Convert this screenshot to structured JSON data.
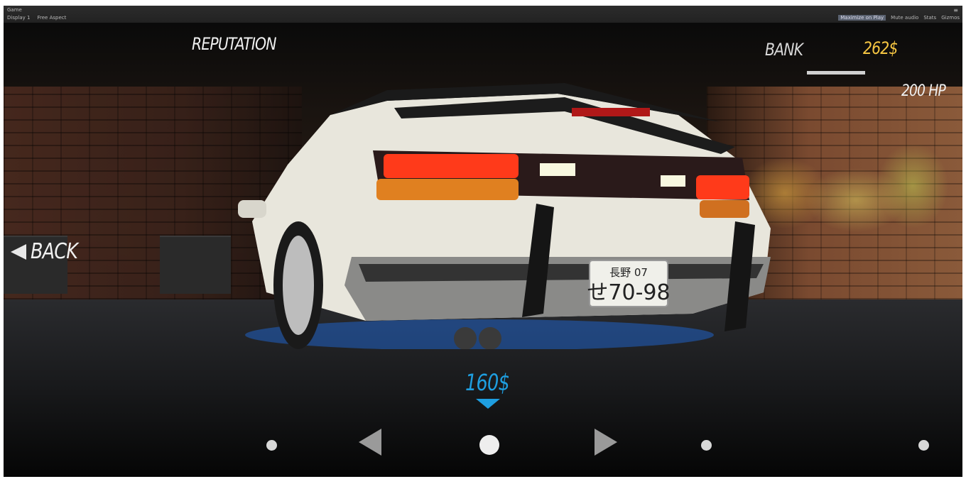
{
  "window": {
    "title": "Game",
    "display": "Display 1",
    "aspect": "Free Aspect",
    "toolbar_right": [
      "Maximize on Play",
      "Mute audio",
      "Stats",
      "Gizmos"
    ]
  },
  "hud": {
    "reputation_label": "REPUTATION",
    "bank_label": "BANK",
    "bank_value": "262$",
    "horsepower": "200 HP",
    "back_label": "BACK",
    "price": "160$"
  },
  "plate": {
    "top": "長野 07",
    "bottom": "せ70-98"
  },
  "colors": {
    "bank_value": "#f5c542",
    "price": "#1e9ee0",
    "hud_text": "#f0f0f0"
  }
}
